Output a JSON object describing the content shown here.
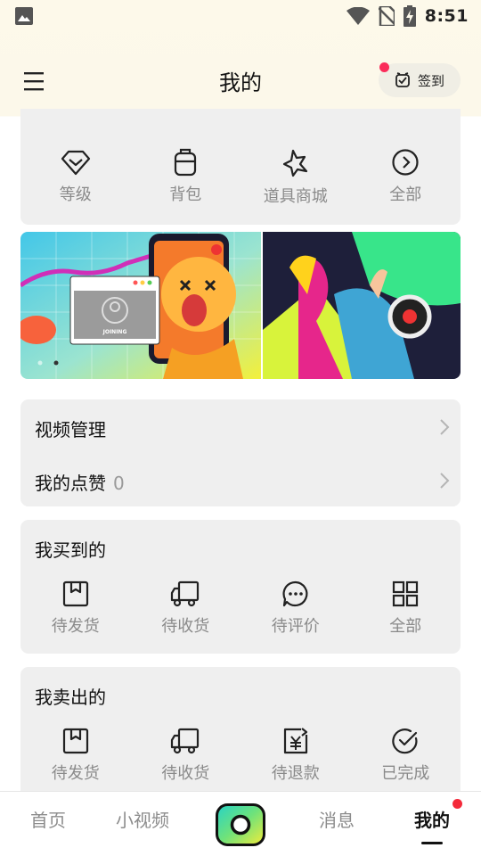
{
  "status_bar": {
    "time": "8:51"
  },
  "header": {
    "title": "我的",
    "signin_label": "签到"
  },
  "live_services": {
    "items": [
      {
        "label": "等级",
        "icon": "diamond-icon"
      },
      {
        "label": "背包",
        "icon": "backpack-icon"
      },
      {
        "label": "道具商城",
        "icon": "star-icon"
      },
      {
        "label": "全部",
        "icon": "chevron-circle-icon"
      }
    ]
  },
  "banner": {
    "badge_text": "JOINING"
  },
  "video_section": {
    "rows": [
      {
        "label": "视频管理"
      },
      {
        "label": "我的点赞",
        "count": "0"
      }
    ]
  },
  "bought": {
    "title": "我买到的",
    "items": [
      {
        "label": "待发货",
        "icon": "package-icon"
      },
      {
        "label": "待收货",
        "icon": "truck-icon"
      },
      {
        "label": "待评价",
        "icon": "comment-icon"
      },
      {
        "label": "全部",
        "icon": "grid-icon"
      }
    ]
  },
  "sold": {
    "title": "我卖出的",
    "items": [
      {
        "label": "待发货",
        "icon": "package-icon"
      },
      {
        "label": "待收货",
        "icon": "truck-icon"
      },
      {
        "label": "待退款",
        "icon": "refund-icon"
      },
      {
        "label": "已完成",
        "icon": "check-circle-icon"
      }
    ]
  },
  "tabbar": {
    "tabs": [
      {
        "label": "首页"
      },
      {
        "label": "小视频"
      },
      {
        "label": "消息"
      },
      {
        "label": "我的"
      }
    ],
    "accent": "#fb2c5a"
  }
}
